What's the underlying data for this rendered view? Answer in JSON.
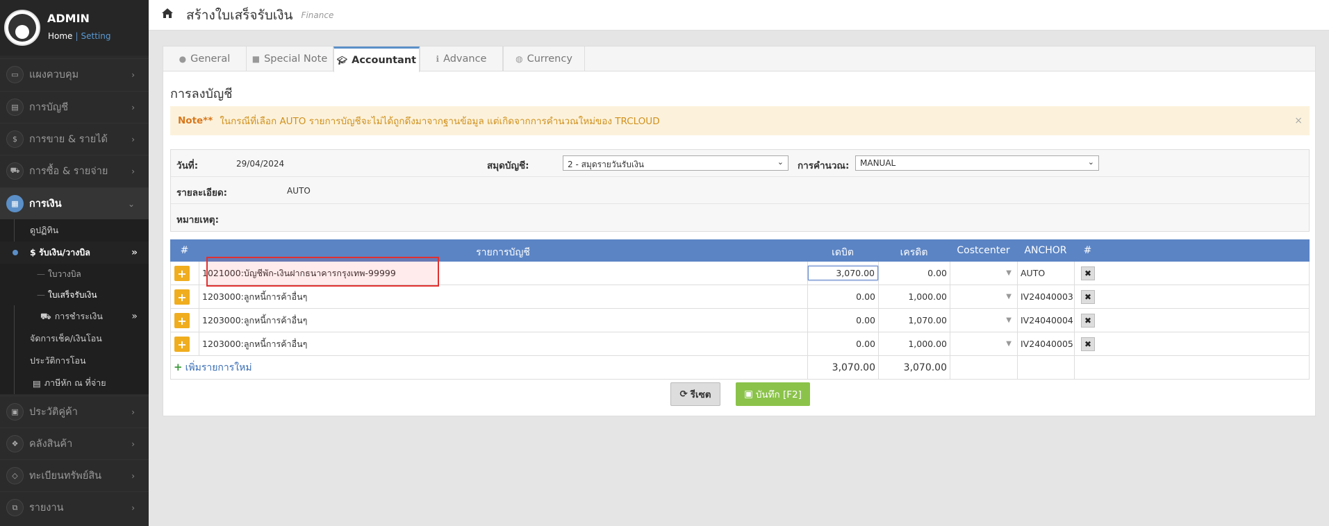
{
  "sidebar": {
    "user": "ADMIN",
    "home_link": "Home",
    "separator": "|",
    "setting_link": "Setting",
    "menu": [
      {
        "label": "แผงควบคุม",
        "icon": "monitor-icon"
      },
      {
        "label": "การบัญชี",
        "icon": "book-icon"
      },
      {
        "label": "การขาย & รายได้",
        "icon": "dollar-icon"
      },
      {
        "label": "การซื้อ & รายจ่าย",
        "icon": "cart-icon"
      },
      {
        "label": "การเงิน",
        "icon": "calendar-icon"
      },
      {
        "label": "ประวัติคู่ค้า",
        "icon": "contact-icon"
      },
      {
        "label": "คลังสินค้า",
        "icon": "cubes-icon"
      },
      {
        "label": "ทะเบียนทรัพย์สิน",
        "icon": "diamond-icon"
      },
      {
        "label": "รายงาน",
        "icon": "copy-icon"
      }
    ],
    "finance_sub": [
      {
        "label": "ดูปฏิทิน"
      },
      {
        "label": "$ รับเงิน/วางบิล"
      },
      {
        "label": "ใบวางบิล"
      },
      {
        "label": "ใบเสร็จรับเงิน"
      },
      {
        "label": "การชำระเงิน"
      },
      {
        "label": "จัดการเช็ค/เงินโอน"
      },
      {
        "label": "ประวัติการโอน"
      },
      {
        "label": "ภาษีหัก ณ ที่จ่าย"
      }
    ]
  },
  "header": {
    "title": "สร้างใบเสร็จรับเงิน",
    "subtitle": "Finance"
  },
  "tabs": [
    {
      "label": "General",
      "icon": "user-icon"
    },
    {
      "label": "Special Note",
      "icon": "note-icon"
    },
    {
      "label": "Accountant",
      "icon": "graduation-cap-icon"
    },
    {
      "label": "Advance",
      "icon": "info-icon"
    },
    {
      "label": "Currency",
      "icon": "globe-icon"
    }
  ],
  "section_title": "การลงบัญชี",
  "note": {
    "prefix": "Note**",
    "text": "ในกรณีที่เลือก AUTO รายการบัญชีจะไม่ได้ถูกดึงมาจากฐานข้อมูล แต่เกิดจากการคำนวณใหม่ของ TRCLOUD",
    "close": "×"
  },
  "form": {
    "date_label": "วันที่:",
    "date_value": "29/04/2024",
    "book_label": "สมุดบัญชี:",
    "book_value": "2 - สมุดรายวันรับเงิน",
    "calc_label": "การคำนวณ:",
    "calc_value": "MANUAL",
    "detail_label": "รายละเอียด:",
    "detail_value": "AUTO",
    "remark_label": "หมายเหตุ:"
  },
  "table": {
    "headers": [
      "#",
      "รายการบัญชี",
      "เดบิต",
      "เครดิต",
      "Costcenter",
      "ANCHOR",
      "#"
    ],
    "rows": [
      {
        "account": "1021000:บัญชีพัก-เงินฝากธนาคารกรุงเทพ-99999",
        "debit": "3,070.00",
        "credit": "0.00",
        "anchor": "AUTO"
      },
      {
        "account": "1203000:ลูกหนี้การค้าอื่นๆ",
        "debit": "0.00",
        "credit": "1,000.00",
        "anchor": "IV24040003"
      },
      {
        "account": "1203000:ลูกหนี้การค้าอื่นๆ",
        "debit": "0.00",
        "credit": "1,070.00",
        "anchor": "IV24040004"
      },
      {
        "account": "1203000:ลูกหนี้การค้าอื่นๆ",
        "debit": "0.00",
        "credit": "1,000.00",
        "anchor": "IV24040005"
      }
    ],
    "add_label": "เพิ่มรายการใหม่",
    "total_debit": "3,070.00",
    "total_credit": "3,070.00"
  },
  "buttons": {
    "reset": "รีเซต",
    "save": "บันทึก [F2]"
  }
}
